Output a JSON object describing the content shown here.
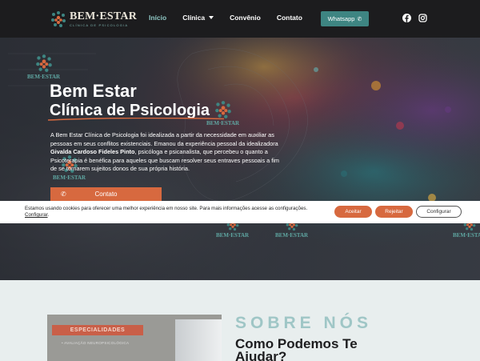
{
  "header": {
    "logo_name": "BEM·ESTAR",
    "logo_sub": "CLÍNICA DE PSICOLOGIA",
    "nav": [
      {
        "label": "Início",
        "active": true
      },
      {
        "label": "Clínica",
        "dropdown": true
      },
      {
        "label": "Convênio"
      },
      {
        "label": "Contato"
      }
    ],
    "whatsapp_label": "Whatsapp",
    "social": [
      "facebook-icon",
      "instagram-icon"
    ]
  },
  "hero": {
    "title": "Bem Estar",
    "subtitle": "Clínica de Psicologia",
    "text_part1": "A Bem Estar Clínica de Psicologia foi idealizada a partir da necessidade em auxiliar as pessoas em seus conflitos existenciais. Emanou da experiência pessoal da idealizadora ",
    "text_bold": "Givalda Cardoso Fideles Pinto",
    "text_part2": ", psicóloga e psicanalista, que percebeu o quanto a Psicoterapia é benéfica para aqueles que buscam resolver seus entraves pessoais a fim de se tornarem sujeitos donos de sua própria história.",
    "button_label": "Contato",
    "watermark_text": "BEM·ESTAR"
  },
  "cookie": {
    "text": "Estamos usando cookies para oferecer uma melhor experiência em nosso site. Para mais informações acesse as configurações.",
    "link": "Configurar",
    "accept": "Aceitar",
    "reject": "Rejeitar",
    "config": "Configurar"
  },
  "about": {
    "eyebrow": "SOBRE NÓS",
    "title": "Como Podemos Te Ajudar?",
    "photo_sign": "ESPECIALIDADES",
    "photo_note": "• AVALIAÇÃO NEUROPSICOLÓGICA"
  },
  "colors": {
    "header_bg": "#1c1c1e",
    "accent_teal": "#3e8582",
    "accent_orange": "#d7693f",
    "eyebrow_teal": "#9fc6c6",
    "section_bg": "#e8eeee"
  }
}
